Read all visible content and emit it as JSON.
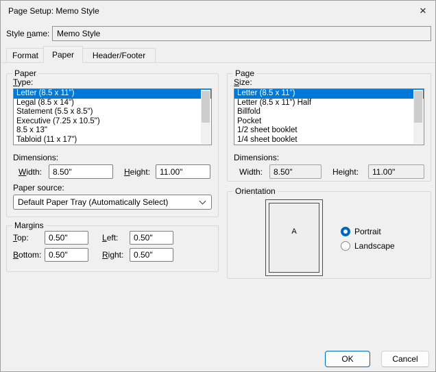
{
  "window": {
    "title": "Page Setup: Memo Style",
    "close_glyph": "×"
  },
  "style_name": {
    "label": "Style &name:",
    "value": "Memo Style"
  },
  "tabs": [
    {
      "label": "Format"
    },
    {
      "label": "Paper"
    },
    {
      "label": "Header/Footer"
    }
  ],
  "paper": {
    "caption": "Paper",
    "type_label": "&Type:",
    "type_items": [
      "Letter (8.5 x 11\")",
      "Legal (8.5 x 14\")",
      "Statement (5.5 x 8.5\")",
      "Executive (7.25 x 10.5\")",
      "8.5 x 13\"",
      "Tabloid (11 x 17\")"
    ],
    "selected_type_index": 0,
    "dimensions_label": "Dimensions:",
    "width_label": "&Width:",
    "width_value": "8.50\"",
    "height_label": "&Height:",
    "height_value": "11.00\"",
    "source_label": "Paper source:",
    "source_value": "Default Paper Tray (Automatically Select)"
  },
  "page": {
    "caption": "Page",
    "size_label": "&Size:",
    "size_items": [
      "Letter (8.5 x 11\")",
      "Letter (8.5 x 11\") Half",
      "Billfold",
      "Pocket",
      "1/2 sheet booklet",
      "1/4 sheet booklet"
    ],
    "selected_size_index": 0,
    "dimensions_label": "Dimensions:",
    "width_label": "Width:",
    "width_value": "8.50\"",
    "height_label": "Height:",
    "height_value": "11.00\""
  },
  "margins": {
    "caption": "Margins",
    "top_label": "&Top:",
    "top_value": "0.50\"",
    "bottom_label": "&Bottom:",
    "bottom_value": "0.50\"",
    "left_label": "&Left:",
    "left_value": "0.50\"",
    "right_label": "&Right:",
    "right_value": "0.50\""
  },
  "orientation": {
    "caption": "Orientation",
    "preview_letter": "A",
    "portrait_label": "Portrait",
    "landscape_label": "Landscape",
    "selected": "Portrait"
  },
  "buttons": {
    "ok": "OK",
    "cancel": "Cancel"
  },
  "colors": {
    "accent": "#0067c0",
    "selection": "#0078d7"
  }
}
